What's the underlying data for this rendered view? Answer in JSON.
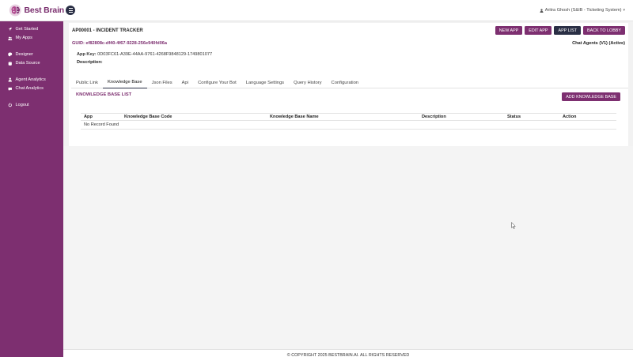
{
  "brand": {
    "name": "Best Brain"
  },
  "user": {
    "label": "Aritra Ghosh (S&IB - Ticketing System)"
  },
  "sidebar": {
    "items": [
      {
        "label": "Get Started",
        "icon": "rocket-icon"
      },
      {
        "label": "My Apps",
        "icon": "users-icon"
      },
      {
        "label": "Designer",
        "icon": "palette-icon"
      },
      {
        "label": "Data Source",
        "icon": "database-icon"
      },
      {
        "label": "Agent Analytics",
        "icon": "agent-icon"
      },
      {
        "label": "Chat Analytics",
        "icon": "chat-icon"
      },
      {
        "label": "Logout",
        "icon": "power-icon"
      }
    ]
  },
  "header": {
    "title": "AP00001 - INCIDENT TRACKER",
    "buttons": {
      "new_app": "NEW APP",
      "edit_app": "EDIT APP",
      "app_list": "APP LIST",
      "back_to_lobby": "BACK TO LOBBY"
    },
    "guid": "GUID: ef82808c-df40-4f67-9228-256e940fd06a",
    "agent": "Chat Agents (V1) (Active)",
    "app_key_label": "App Key:",
    "app_key_value": "0D03FC61-A39E-44AA-9761-4268F9848129-1749801077",
    "description_label": "Description:"
  },
  "tabs": [
    {
      "label": "Public Link",
      "active": false
    },
    {
      "label": "Knowledge Base",
      "active": true
    },
    {
      "label": "Json Files",
      "active": false
    },
    {
      "label": "Api",
      "active": false
    },
    {
      "label": "Configure Your Bot",
      "active": false
    },
    {
      "label": "Language Settings",
      "active": false
    },
    {
      "label": "Query History",
      "active": false
    },
    {
      "label": "Configuration",
      "active": false
    }
  ],
  "knowledge_base": {
    "title": "KNOWLEDGE BASE LIST",
    "add_button": "ADD KNOWLEDGE BASE",
    "columns": [
      "App",
      "Knowledge Base Code",
      "Knowledge Base Name",
      "Description",
      "Status",
      "Action"
    ],
    "empty_text": "No Record Found"
  },
  "footer": {
    "text": "© COPYRIGHT 2025 BESTBRAIN.AI. ALL RIGHTS RESERVED"
  },
  "colors": {
    "accent": "#7d2f70",
    "dark": "#2a2f45"
  }
}
